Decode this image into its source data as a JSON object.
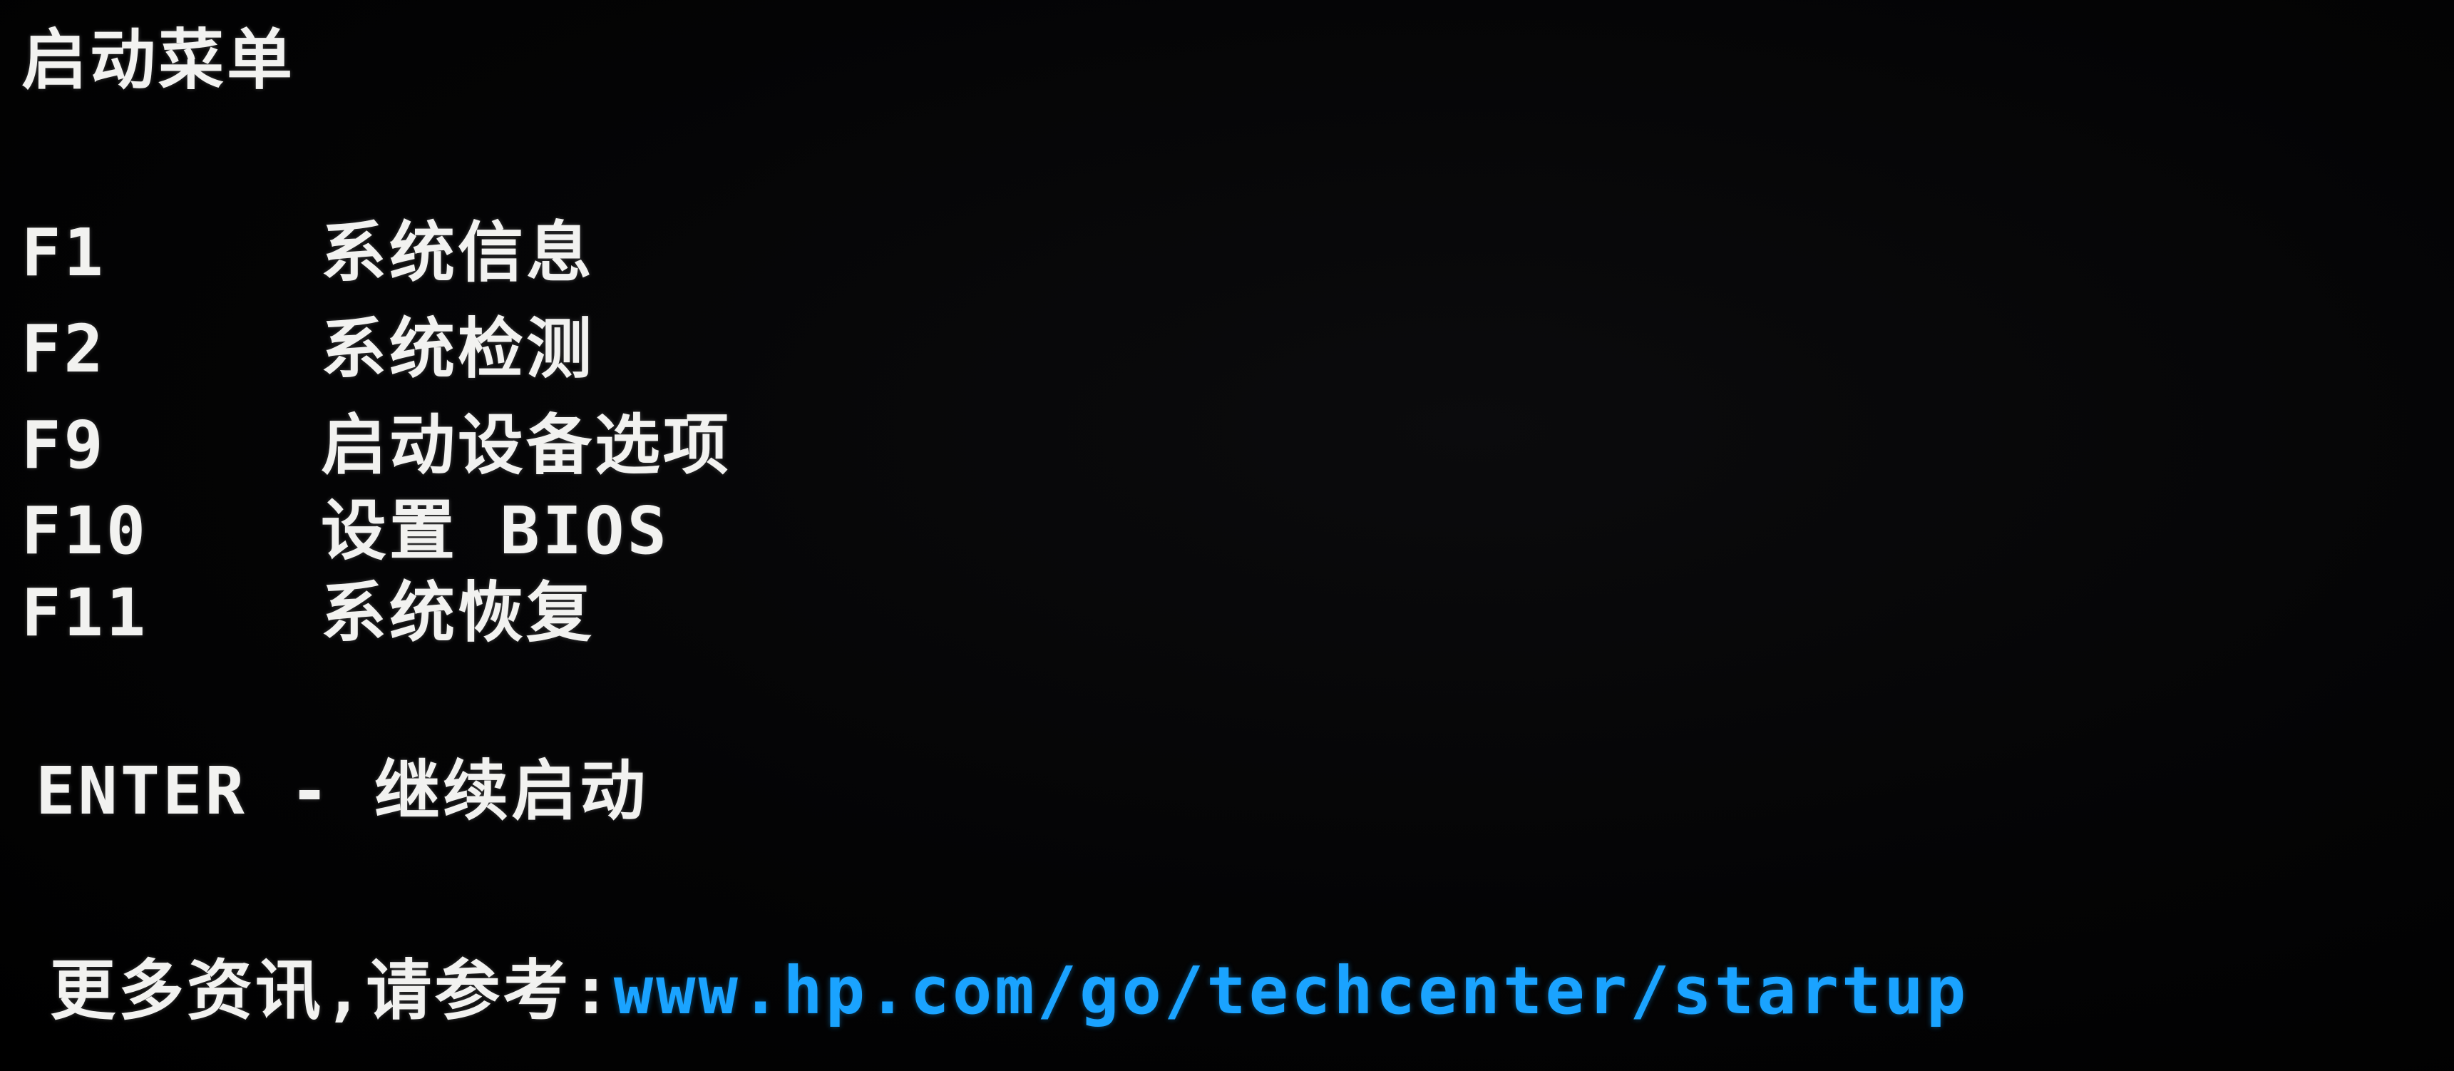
{
  "menu": {
    "title": "启动菜单",
    "items": [
      {
        "key": "F1",
        "label": "系统信息"
      },
      {
        "key": "F2",
        "label": "系统检测"
      },
      {
        "key": "F9",
        "label": "启动设备选项"
      },
      {
        "key": "F10",
        "label": "设置 BIOS"
      },
      {
        "key": "F11",
        "label": "系统恢复"
      }
    ]
  },
  "enter": {
    "text": "ENTER - 继续启动"
  },
  "info": {
    "prefix": "更多资讯,请参考:",
    "link": "www.hp.com/go/techcenter/startup"
  },
  "colors": {
    "text": "#f2f2f0",
    "link": "#1aa3ff",
    "background": "#000000"
  }
}
